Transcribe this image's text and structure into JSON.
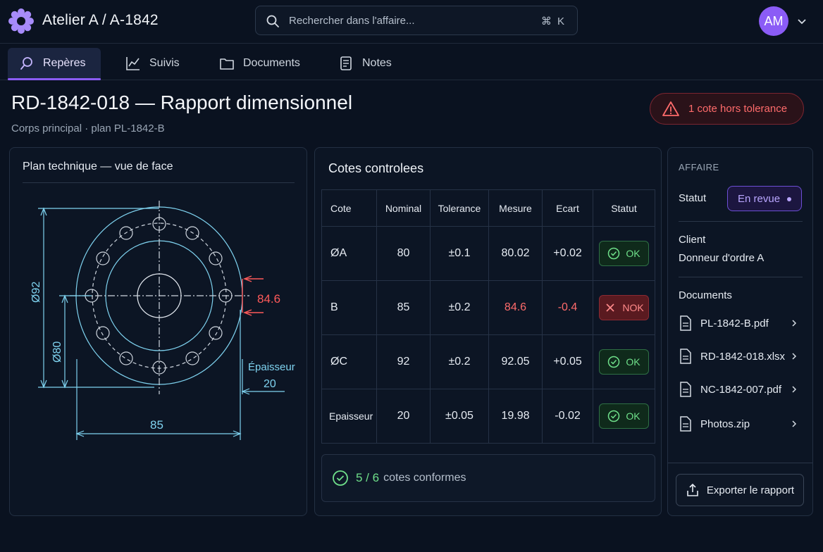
{
  "app": {
    "title": "Atelier A / A-1842"
  },
  "search": {
    "placeholder": "Rechercher dans l'affaire...",
    "shortcut": "⌘ K"
  },
  "user": {
    "initials": "AM"
  },
  "tabs": [
    {
      "label": "Repères",
      "active": true,
      "icon": "pin-icon"
    },
    {
      "label": "Suivis",
      "active": false,
      "icon": "chart-line-icon"
    },
    {
      "label": "Documents",
      "active": false,
      "icon": "folder-icon"
    },
    {
      "label": "Notes",
      "active": false,
      "icon": "note-icon"
    }
  ],
  "header": {
    "title": "RD-1842-018 — Rapport dimensionnel",
    "subtitle": "Corps principal · plan PL-1842-B",
    "alert": "1 cote hors tolerance"
  },
  "plan": {
    "title": "Plan technique — vue de face",
    "dims": {
      "d92": "Ø92",
      "d80": "Ø80",
      "w85": "85",
      "measured": "84.6",
      "thickness_label": "Épaisseur",
      "thickness_value": "20"
    }
  },
  "cotes": {
    "title": "Cotes controlees",
    "headers": [
      "Cote",
      "Nominal",
      "Tolerance",
      "Mesure",
      "Ecart",
      "Statut"
    ],
    "rows": [
      {
        "cote": "ØA",
        "nominal": "80",
        "tolerance": "±0.1",
        "mesure": "80.02",
        "ecart": "+0.02",
        "statut": "OK"
      },
      {
        "cote": "B",
        "nominal": "85",
        "tolerance": "±0.2",
        "mesure": "84.6",
        "ecart": "-0.4",
        "statut": "NOK"
      },
      {
        "cote": "ØC",
        "nominal": "92",
        "tolerance": "±0.2",
        "mesure": "92.05",
        "ecart": "+0.05",
        "statut": "OK"
      },
      {
        "cote": "Epaisseur",
        "nominal": "20",
        "tolerance": "±0.05",
        "mesure": "19.98",
        "ecart": "-0.02",
        "statut": "OK"
      }
    ],
    "summary_count": "5 / 6",
    "summary_label": "cotes conformes"
  },
  "side": {
    "heading": "AFFAIRE",
    "statut_label": "Statut",
    "statut_value": "En revue",
    "client_label": "Client",
    "client_value": "Donneur d'ordre A",
    "documents_label": "Documents",
    "documents": [
      "PL-1842-B.pdf",
      "RD-1842-018.xlsx",
      "NC-1842-007.pdf",
      "Photos.zip"
    ],
    "export_label": "Exporter le rapport"
  },
  "colors": {
    "accent": "#8b5cf6",
    "ok": "#6fe08a",
    "nok": "#ff6b6b",
    "drawing": "#7fd3f0"
  }
}
